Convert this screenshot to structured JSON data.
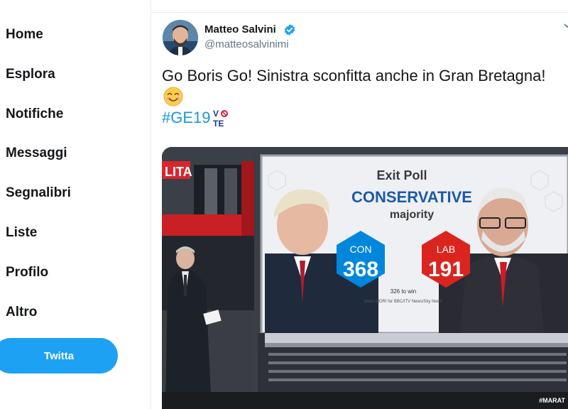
{
  "sidebar": {
    "items": [
      {
        "label": "Home"
      },
      {
        "label": "Esplora"
      },
      {
        "label": "Notifiche"
      },
      {
        "label": "Messaggi"
      },
      {
        "label": "Segnalibri"
      },
      {
        "label": "Liste"
      },
      {
        "label": "Profilo"
      },
      {
        "label": "Altro"
      }
    ],
    "tweet_button": "Twitta"
  },
  "tweet": {
    "author_name": "Matteo Salvini",
    "author_handle": "@matteosalvinimi",
    "text": "Go Boris Go! Sinistra sconfitta anche in Gran Bretagna!",
    "emoji": "smiling-face-icon",
    "hashtag": "#GE19",
    "hashflag": "VOTE"
  },
  "media": {
    "screen_brand": "LITA",
    "poll_title": "Exit Poll",
    "poll_headline": "CONSERVATIVE",
    "poll_subheadline": "majority",
    "con_label": "CON",
    "con_seats": "368",
    "lab_label": "LAB",
    "lab_seats": "191",
    "win_threshold": "326 to win",
    "poll_source": "Ipsos MORI for BBC/ITV News/Sky News",
    "ticker": "#MARAT",
    "colors": {
      "con": "#0087dc",
      "lab": "#dc241f",
      "headline": "#1d5aa8",
      "accent": "#1da1f2"
    }
  }
}
